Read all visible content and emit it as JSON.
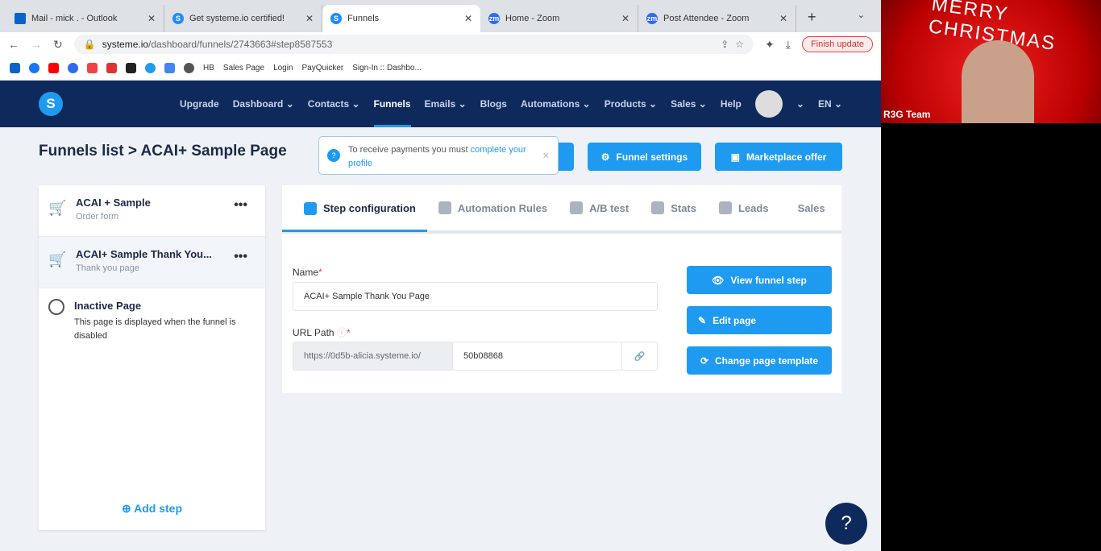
{
  "browser": {
    "tabs": [
      {
        "title": "Mail - mick . - Outlook",
        "icon": "outlook"
      },
      {
        "title": "Get systeme.io certified!",
        "icon": "S"
      },
      {
        "title": "Funnels",
        "icon": "S",
        "active": true
      },
      {
        "title": "Home - Zoom",
        "icon": "zm"
      },
      {
        "title": "Post Attendee - Zoom",
        "icon": "zm"
      }
    ],
    "url_domain": "systeme.io",
    "url_path": "/dashboard/funnels/2743663#step8587553",
    "finish_update": "Finish update",
    "bookmarks": [
      "HB",
      "Sales Page",
      "Login",
      "PayQuicker",
      "Sign-In :: Dashbo..."
    ]
  },
  "nav": {
    "logo": "S",
    "items": [
      "Upgrade",
      "Dashboard",
      "Contacts",
      "Funnels",
      "Emails",
      "Blogs",
      "Automations",
      "Products",
      "Sales",
      "Help"
    ],
    "active": "Funnels",
    "lang": "EN"
  },
  "breadcrumb": {
    "root": "Funnels list",
    "sep": ">",
    "current": "ACAI+ Sample Page"
  },
  "toast": {
    "text": "To receive payments you must ",
    "link": "complete your profile"
  },
  "buttons": {
    "funnel_settings": "Funnel settings",
    "marketplace": "Marketplace offer"
  },
  "steps": [
    {
      "name": "ACAI + Sample",
      "type": "Order form"
    },
    {
      "name": "ACAI+ Sample Thank You...",
      "type": "Thank you page"
    }
  ],
  "inactive": {
    "title": "Inactive Page",
    "desc": "This page is displayed when the funnel is disabled"
  },
  "add_step": "Add step",
  "tabs": [
    "Step configuration",
    "Automation Rules",
    "A/B test",
    "Stats",
    "Leads",
    "Sales"
  ],
  "form": {
    "name_label": "Name",
    "name_value": "ACAI+ Sample Thank You Page",
    "url_label": "URL Path",
    "url_prefix": "https://0d5b-alicia.systeme.io/",
    "url_value": "50b08868"
  },
  "actions": {
    "view": "View funnel step",
    "edit": "Edit page",
    "template": "Change page template"
  },
  "video": {
    "name": "R3G Team",
    "banner": "MERRY CHRISTMAS"
  },
  "help": "?"
}
